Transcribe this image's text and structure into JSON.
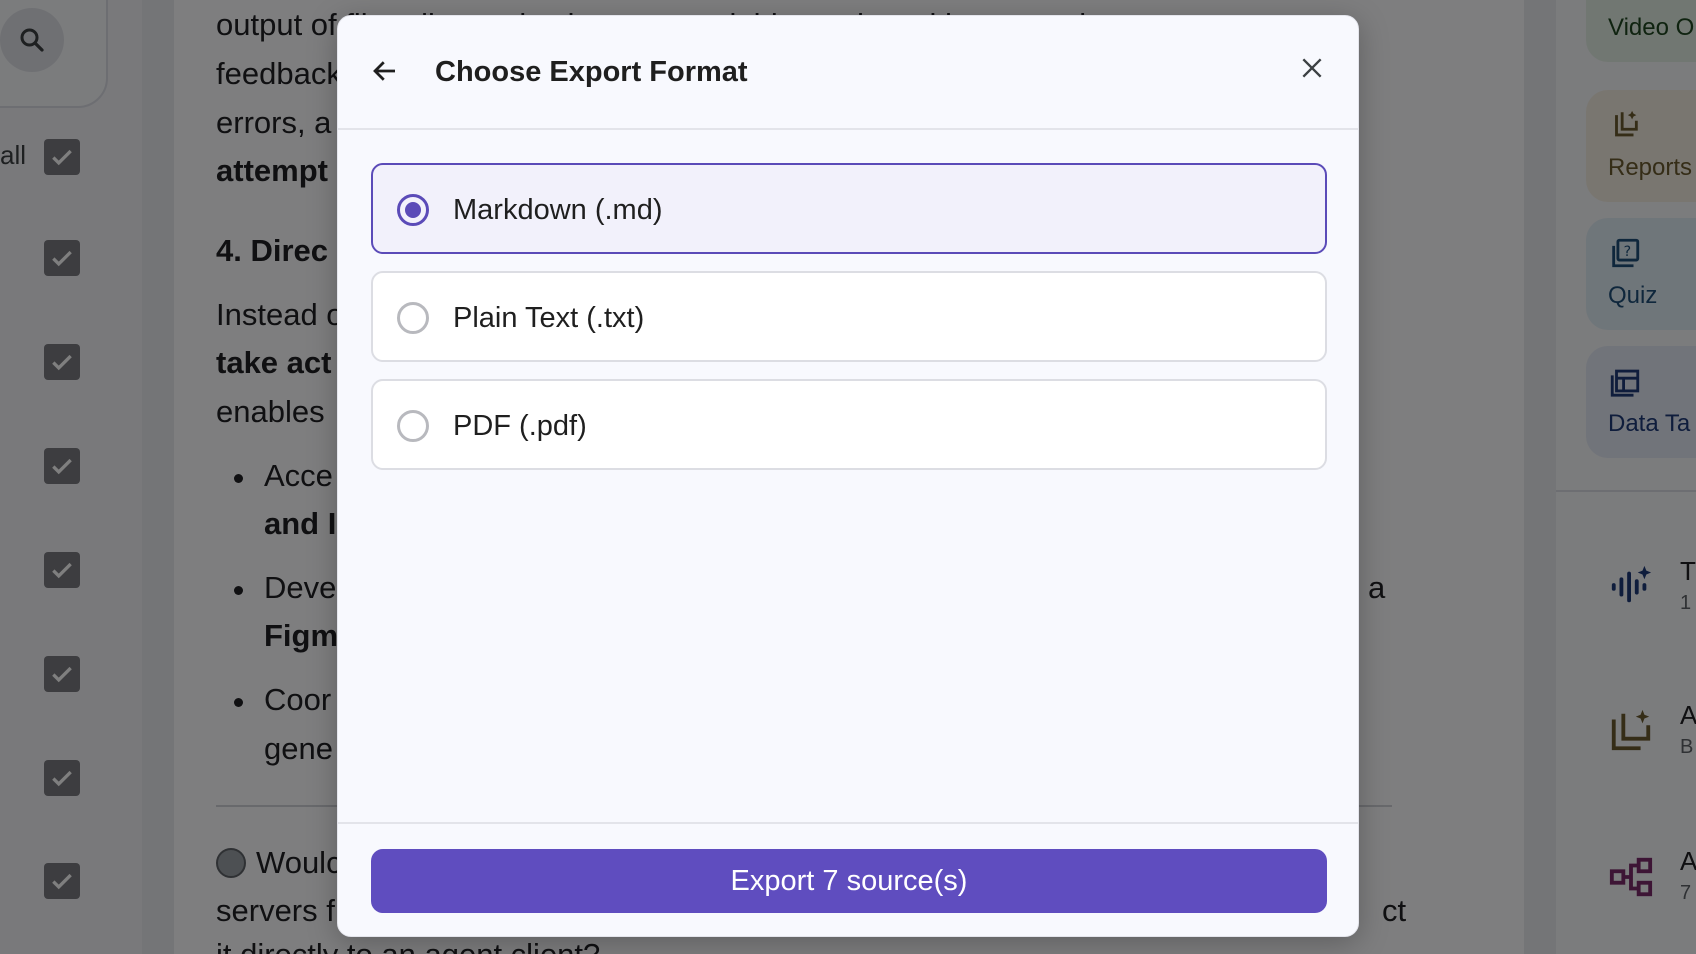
{
  "background": {
    "sidebar": {
      "select_all_label": "all",
      "checkbox_count": 8
    },
    "content": {
      "lines": [
        {
          "text": "output of file edits, code changes, variable, and ... with ... error loops,",
          "bold": false
        },
        {
          "text": "feedback",
          "bold": false
        },
        {
          "text": "errors, a",
          "bold": false
        },
        {
          "text": "attempt",
          "bold": true
        },
        {
          "text": "4. Direc",
          "bold": true
        },
        {
          "text": "Instead o",
          "bold": false
        },
        {
          "text": "take act",
          "bold": true
        },
        {
          "text": "enables",
          "bold": false
        },
        {
          "text": "Acce",
          "bold": false
        },
        {
          "text": "and I",
          "bold": true
        },
        {
          "text": "Deve",
          "bold": false
        },
        {
          "text": "a",
          "bold": false
        },
        {
          "text": "Figm",
          "bold": true
        },
        {
          "text": "Coor",
          "bold": false
        },
        {
          "text": "gene",
          "bold": false
        },
        {
          "text": "Woulc",
          "bold": false
        },
        {
          "text": "servers f",
          "bold": false
        },
        {
          "text": "ct",
          "bold": false
        },
        {
          "text": "it directly to an agent client?",
          "bold": false
        }
      ]
    },
    "studio": {
      "tiles": [
        {
          "label": "Video O",
          "icon": "video-icon",
          "color": "#e3efe4",
          "text_color": "#1e4620"
        },
        {
          "label": "Reports",
          "icon": "report-icon",
          "color": "#f3ede1",
          "text_color": "#6b5a2e"
        },
        {
          "label": "Quiz",
          "icon": "quiz-icon",
          "color": "#dfecf5",
          "text_color": "#1f4f78"
        },
        {
          "label": "Data Ta",
          "icon": "table-icon",
          "color": "#e2e8f5",
          "text_color": "#1f3a78"
        }
      ],
      "items": [
        {
          "letter": "T",
          "sub": "1",
          "icon": "audio-sparkle-icon"
        },
        {
          "letter": "A",
          "sub": "B",
          "icon": "report-sparkle-icon"
        },
        {
          "letter": "A",
          "sub": "7",
          "icon": "mindmap-icon"
        }
      ]
    }
  },
  "dialog": {
    "title": "Choose Export Format",
    "back_icon": "arrow-left-icon",
    "close_icon": "close-icon",
    "options": [
      {
        "label": "Markdown (.md)",
        "selected": true
      },
      {
        "label": "Plain Text (.txt)",
        "selected": false
      },
      {
        "label": "PDF (.pdf)",
        "selected": false
      }
    ],
    "export_button": "Export 7 source(s)",
    "accent_color": "#5f4dbf"
  }
}
